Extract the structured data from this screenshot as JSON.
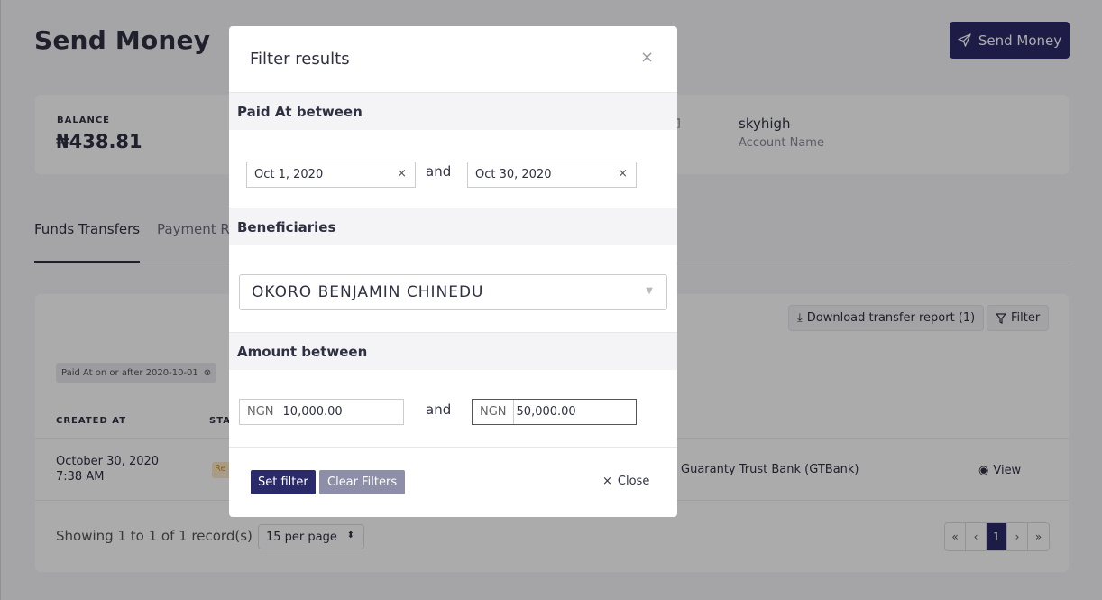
{
  "header": {
    "title": "Send Money",
    "send_button": "Send Money"
  },
  "balance": {
    "label": "BALANCE",
    "value": "₦438.81",
    "account_name": "skyhigh",
    "account_name_label": "Account Name"
  },
  "tabs": [
    {
      "label": "Funds Transfers",
      "active": true
    },
    {
      "label": "Payment Re"
    }
  ],
  "table": {
    "download_button": "Download transfer report (1)",
    "filter_button": "Filter",
    "active_filter_chip": "Paid At on or after 2020-10-01",
    "columns": [
      "CREATED AT",
      "STAT"
    ],
    "rows": [
      {
        "date": "October 30, 2020",
        "time": "7:38 AM",
        "status": "Re",
        "bank": "Guaranty Trust Bank (GTBank)",
        "action": "View"
      }
    ],
    "showing": "Showing 1 to 1 of 1 record(s)",
    "per_page": "15 per page",
    "pager": [
      "«",
      "‹",
      "1",
      "›",
      "»"
    ]
  },
  "modal": {
    "title": "Filter results",
    "paid_at_heading": "Paid At between",
    "date_from": "Oct 1, 2020",
    "date_to": "Oct 30, 2020",
    "and_label": "and",
    "beneficiaries_heading": "Beneficiaries",
    "beneficiary_selected": "OKORO BENJAMIN CHINEDU",
    "amount_heading": "Amount between",
    "currency": "NGN",
    "amount_from": "10,000.00",
    "amount_to": "50,000.00",
    "set_filter": "Set filter",
    "clear_filters": "Clear Filters",
    "close": "Close"
  },
  "colors": {
    "primary": "#2a2a6a",
    "secondary_button": "#8d8fa8",
    "overlay": "rgba(0,0,0,0.33)"
  }
}
